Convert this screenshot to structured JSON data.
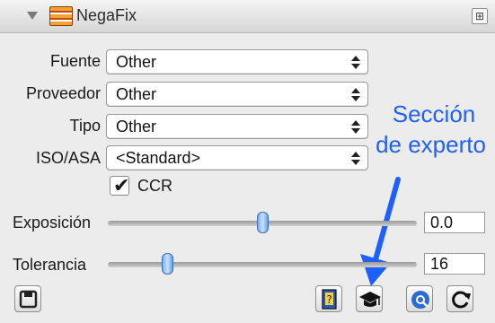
{
  "header": {
    "title": "NegaFix",
    "collapse_glyph": "⊞"
  },
  "fields": [
    {
      "label": "Fuente",
      "value": "Other"
    },
    {
      "label": "Proveedor",
      "value": "Other"
    },
    {
      "label": "Tipo",
      "value": "Other"
    },
    {
      "label": "ISO/ASA",
      "value": "<Standard>"
    }
  ],
  "annotation": {
    "line1": "Sección",
    "line2": "de experto",
    "color": "#1f5fff"
  },
  "ccr": {
    "label": "CCR",
    "checked": true,
    "check_glyph": "✔"
  },
  "sliders": [
    {
      "label": "Exposición",
      "value": "0.0",
      "position": 0.5
    },
    {
      "label": "Tolerancia",
      "value": "16",
      "position": 0.18
    }
  ],
  "toolbar": {
    "icons": [
      "save-icon",
      "help-book-icon",
      "expert-mortarboard-icon",
      "quick-icon",
      "refresh-icon"
    ]
  }
}
